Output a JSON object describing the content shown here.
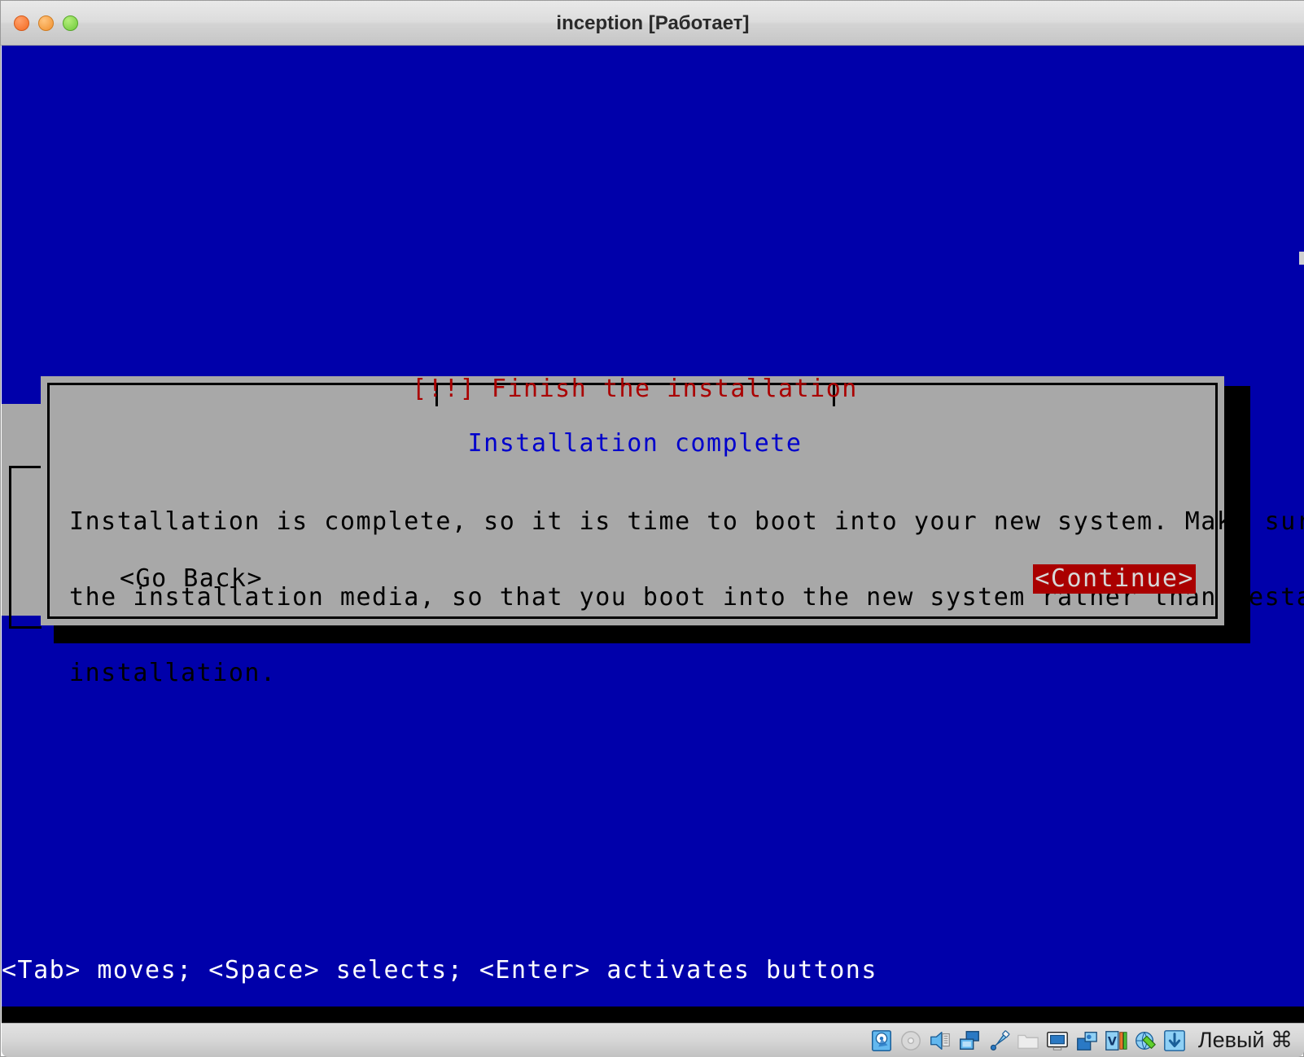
{
  "window": {
    "title": "inception [Работает]",
    "traffic_lights": [
      "close",
      "minimize",
      "zoom"
    ]
  },
  "installer": {
    "dialog_title": "[!!] Finish the installation",
    "heading": "Installation complete",
    "body_lines": [
      "Installation is complete, so it is time to boot into your new system. Make sure to remove",
      "the installation media, so that you boot into the new system rather than restarting the",
      "installation."
    ],
    "buttons": {
      "go_back": "<Go Back>",
      "continue": "<Continue>"
    },
    "status_line": "<Tab> moves; <Space> selects; <Enter> activates buttons",
    "colors": {
      "screen_background": "#0000aa",
      "dialog_background": "#a8a8a8",
      "title_red": "#aa0000",
      "heading_blue": "#0000cc",
      "selected_button_background": "#aa0000",
      "selected_button_text": "#d8d8d8",
      "text_black": "#000000",
      "status_text": "#ffffff"
    }
  },
  "statusbar": {
    "host_key_label": "Левый ⌘",
    "icons": [
      {
        "name": "hard-disk-icon",
        "state": "active"
      },
      {
        "name": "optical-disk-icon",
        "state": "inactive"
      },
      {
        "name": "floppy-disk-icon",
        "state": "active"
      },
      {
        "name": "network-icon",
        "state": "active"
      },
      {
        "name": "usb-icon",
        "state": "active"
      },
      {
        "name": "shared-folder-icon",
        "state": "inactive"
      },
      {
        "name": "display-icon",
        "state": "active"
      },
      {
        "name": "video-capture-icon",
        "state": "active"
      },
      {
        "name": "cpu-load-icon",
        "state": "active"
      },
      {
        "name": "globe-mouse-icon",
        "state": "active"
      },
      {
        "name": "host-key-icon",
        "state": "active"
      }
    ]
  }
}
